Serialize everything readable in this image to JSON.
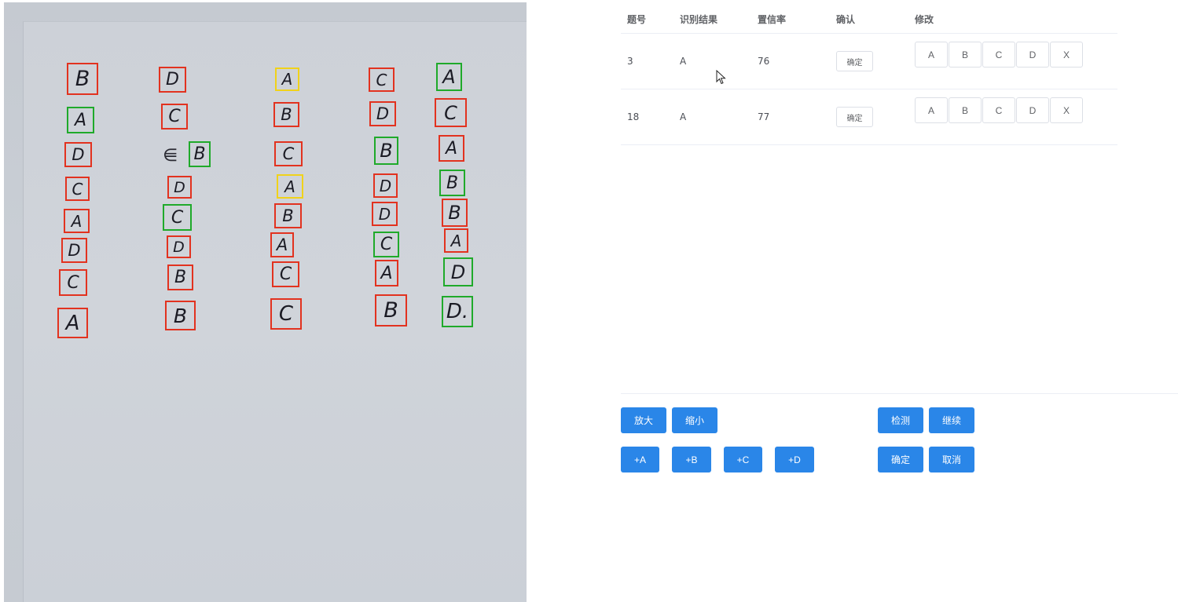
{
  "sheet": {
    "boxes": [
      {
        "letter": "B",
        "color": "red"
      },
      {
        "letter": "A",
        "color": "green"
      },
      {
        "letter": "D",
        "color": "red"
      },
      {
        "letter": "C",
        "color": "red"
      },
      {
        "letter": "A",
        "color": "red"
      },
      {
        "letter": "D",
        "color": "red"
      },
      {
        "letter": "C",
        "color": "red"
      },
      {
        "letter": "A",
        "color": "red"
      },
      {
        "letter": "D",
        "color": "red"
      },
      {
        "letter": "C",
        "color": "red"
      },
      {
        "letter": "B",
        "color": "green"
      },
      {
        "letter": "D",
        "color": "red"
      },
      {
        "letter": "C",
        "color": "green"
      },
      {
        "letter": "D",
        "color": "red"
      },
      {
        "letter": "B",
        "color": "red"
      },
      {
        "letter": "B",
        "color": "red"
      },
      {
        "letter": "A",
        "color": "yellow"
      },
      {
        "letter": "B",
        "color": "red"
      },
      {
        "letter": "C",
        "color": "red"
      },
      {
        "letter": "A",
        "color": "yellow"
      },
      {
        "letter": "B",
        "color": "red"
      },
      {
        "letter": "A",
        "color": "red"
      },
      {
        "letter": "C",
        "color": "red"
      },
      {
        "letter": "C",
        "color": "red"
      },
      {
        "letter": "C",
        "color": "red"
      },
      {
        "letter": "D",
        "color": "red"
      },
      {
        "letter": "B",
        "color": "green"
      },
      {
        "letter": "D",
        "color": "red"
      },
      {
        "letter": "D",
        "color": "red"
      },
      {
        "letter": "C",
        "color": "green"
      },
      {
        "letter": "A",
        "color": "red"
      },
      {
        "letter": "B",
        "color": "red"
      },
      {
        "letter": "A",
        "color": "green"
      },
      {
        "letter": "C",
        "color": "red"
      },
      {
        "letter": "A",
        "color": "red"
      },
      {
        "letter": "B",
        "color": "green"
      },
      {
        "letter": "B",
        "color": "red"
      },
      {
        "letter": "A",
        "color": "red"
      },
      {
        "letter": "D",
        "color": "green"
      },
      {
        "letter": "D.",
        "color": "green"
      }
    ]
  },
  "table": {
    "headers": {
      "num": "题号",
      "result": "识别结果",
      "confidence": "置信率",
      "confirm": "确认",
      "modify": "修改"
    },
    "rows": [
      {
        "num": "3",
        "result": "A",
        "confidence": "76",
        "confirm_label": "确定"
      },
      {
        "num": "18",
        "result": "A",
        "confidence": "77",
        "confirm_label": "确定"
      }
    ],
    "options": [
      "A",
      "B",
      "C",
      "D",
      "X"
    ]
  },
  "controls": {
    "zoom_in": "放大",
    "zoom_out": "缩小",
    "detect": "检测",
    "continue": "继续",
    "add_a": "+A",
    "add_b": "+B",
    "add_c": "+C",
    "add_d": "+D",
    "ok": "确定",
    "cancel": "取消"
  },
  "colors": {
    "primary_button": "#2a86e8",
    "box_red": "#e2321f",
    "box_green": "#1faa2a",
    "box_yellow": "#f0d21a"
  }
}
